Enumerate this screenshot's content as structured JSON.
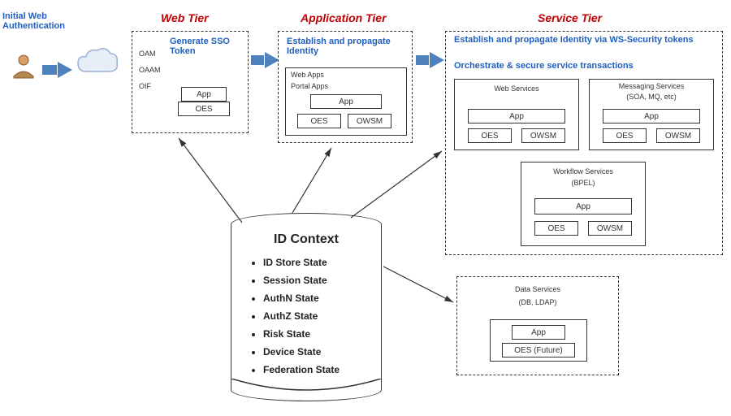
{
  "initial_auth": "Initial Web Authentication",
  "tiers": {
    "web": {
      "title": "Web Tier",
      "subtitle": "Generate SSO Token"
    },
    "app": {
      "title": "Application Tier",
      "subtitle": "Establish and propagate Identity"
    },
    "service": {
      "title": "Service Tier",
      "line1": "Establish and propagate Identity  via WS-Security tokens",
      "line2": "Orchestrate  & secure service transactions"
    }
  },
  "web_tier": {
    "oam": "OAM",
    "oaam": "OAAM",
    "oif": "OIF",
    "app": "App",
    "oes": "OES"
  },
  "app_tier": {
    "web_apps": "Web Apps",
    "portal_apps": "Portal Apps",
    "app": "App",
    "oes": "OES",
    "owsm": "OWSM"
  },
  "service_tier": {
    "web_services": {
      "title": "Web Services",
      "app": "App",
      "oes": "OES",
      "owsm": "OWSM"
    },
    "messaging": {
      "title": "Messaging Services",
      "sub": "(SOA, MQ, etc)",
      "app": "App",
      "oes": "OES",
      "owsm": "OWSM"
    },
    "workflow": {
      "title": "Workflow Services",
      "sub": "(BPEL)",
      "app": "App",
      "oes": "OES",
      "owsm": "OWSM"
    }
  },
  "data_services": {
    "title": "Data Services",
    "sub": "(DB, LDAP)",
    "app": "App",
    "oes_future": "OES (Future)"
  },
  "id_context": {
    "title": "ID Context",
    "items": [
      "ID Store State",
      "Session State",
      "AuthN State",
      "AuthZ State",
      "Risk State",
      "Device State",
      "Federation State"
    ]
  }
}
